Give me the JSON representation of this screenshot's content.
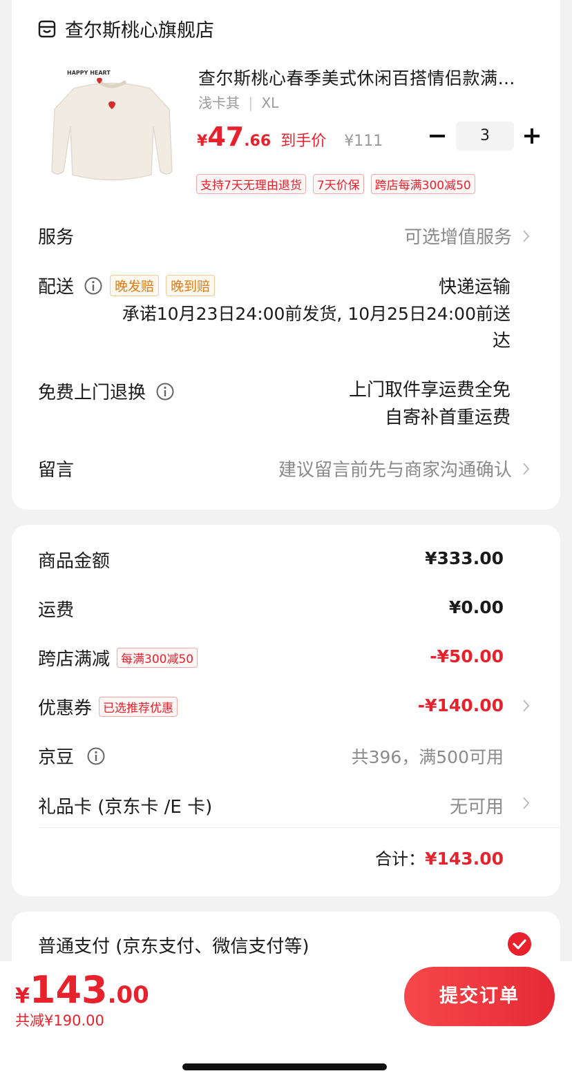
{
  "store": {
    "name": "查尔斯桃心旗舰店"
  },
  "product": {
    "title": "查尔斯桃心春季美式休闲百搭情侣款满…",
    "spec": "浅卡其",
    "size": "XL",
    "price_symbol": "¥",
    "price_int": "47",
    "price_dec": ".66",
    "price_tag": "到手价",
    "original_price": "¥111",
    "quantity": "3",
    "tags": [
      "支持7天无理由退货",
      "7天价保",
      "跨店每满300减50"
    ],
    "image_text": "HAPPY HEART"
  },
  "service": {
    "label": "服务",
    "value": "可选增值服务"
  },
  "delivery": {
    "label": "配送",
    "tags": [
      "晚发赔",
      "晚到赔"
    ],
    "method": "快递运输",
    "promise_line1": "承诺10月23日24:00前发货, 10月25日24:00前送",
    "promise_line2": "达"
  },
  "free_return": {
    "label": "免费上门退换",
    "line1": "上门取件享运费全免",
    "line2": "自寄补首重运费"
  },
  "message": {
    "label": "留言",
    "placeholder": "建议留言前先与商家沟通确认"
  },
  "amounts": {
    "goods_label": "商品金额",
    "goods_value": "¥333.00",
    "shipping_label": "运费",
    "shipping_value": "¥0.00",
    "cross_label": "跨店满减",
    "cross_tag": "每满300减50",
    "cross_value": "-¥50.00",
    "coupon_label": "优惠券",
    "coupon_tag": "已选推荐优惠",
    "coupon_value": "-¥140.00",
    "jd_bean_label": "京豆",
    "jd_bean_value": "共396，满500可用",
    "giftcard_label": "礼品卡 (京东卡 /E 卡)",
    "giftcard_value": "无可用",
    "subtotal_label": "合计：",
    "subtotal_value": "¥143.00"
  },
  "payment": {
    "label": "普通支付 (京东支付、微信支付等)"
  },
  "footer": {
    "total_symbol": "¥",
    "total_int": "143",
    "total_dec": ".00",
    "discount": "共减¥190.00",
    "submit": "提交订单"
  },
  "colors": {
    "accent": "#e8222d",
    "orange": "#e07b16"
  }
}
